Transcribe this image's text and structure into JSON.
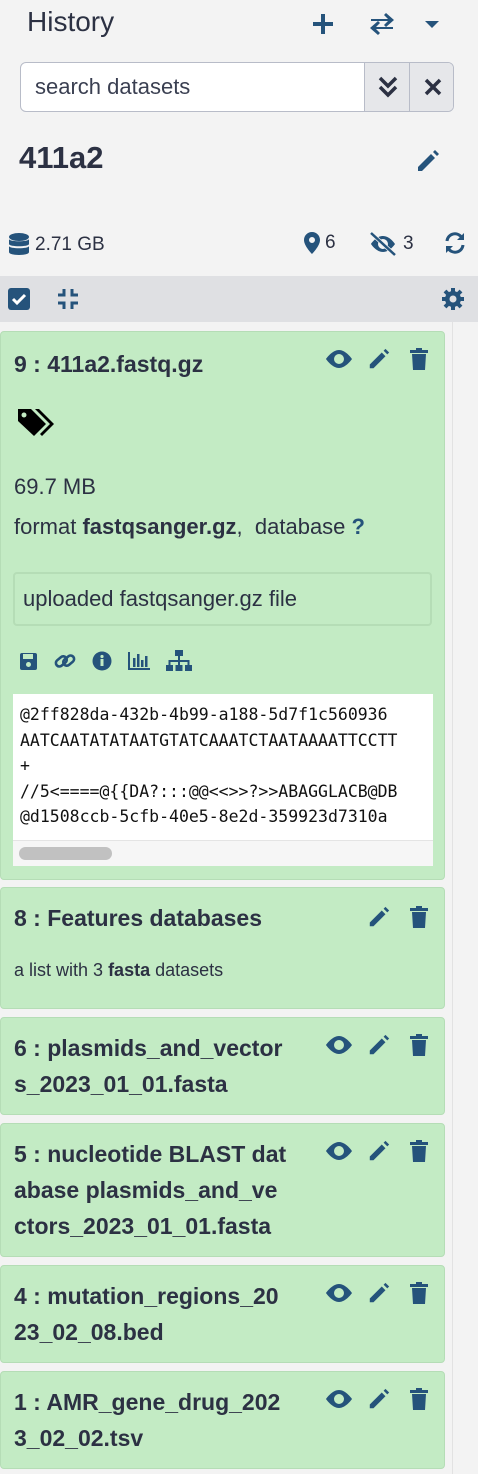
{
  "header": {
    "title": "History",
    "new_icon": "plus-icon",
    "switch_icon": "exchange-icon",
    "menu_icon": "caret-down-icon"
  },
  "search": {
    "placeholder": "search datasets"
  },
  "history": {
    "name": "411a2",
    "size": "2.71 GB",
    "shown_count": "6",
    "hidden_count": "3"
  },
  "items": [
    {
      "title": "9 : 411a2.fastq.gz",
      "size": "69.7 MB",
      "format_label": "format",
      "format_value": "fastqsanger.gz",
      "format_sep": ",",
      "database_label": "database",
      "database_value": "?",
      "description": "uploaded fastqsanger.gz file",
      "peek": [
        "@2ff828da-432b-4b99-a188-5d7f1c560936",
        "AATCAATATATAATGTATCAAATCTAATAAAATTCCTT",
        "+",
        "//5<====@{{DA?:::@@<<>>?>>ABAGGLACB@DB",
        "@d1508ccb-5cfb-40e5-8e2d-359923d7310a"
      ]
    },
    {
      "title": "8 : Features databases",
      "sub_prefix": "a list with 3",
      "sub_bold": "fasta",
      "sub_suffix": "datasets"
    },
    {
      "title_lines": [
        "6 : plasmids_and_vector",
        "s_2023_01_01.fasta"
      ]
    },
    {
      "title_lines": [
        "5 : nucleotide BLAST dat",
        "abase plasmids_and_ve",
        "ctors_2023_01_01.fasta"
      ]
    },
    {
      "title_lines": [
        "4 : mutation_regions_20",
        "23_02_08.bed"
      ]
    },
    {
      "title_lines": [
        "1 : AMR_gene_drug_202",
        "3_02_02.tsv"
      ]
    }
  ],
  "colors": {
    "item_bg": "#c3ebc4",
    "text": "#2c3143",
    "accent": "#25537b"
  }
}
